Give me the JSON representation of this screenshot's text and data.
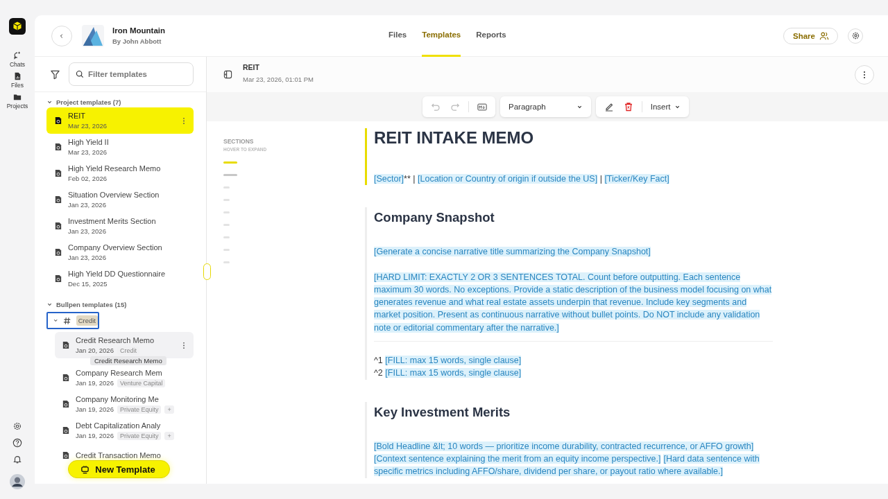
{
  "rail": {
    "nav": [
      {
        "kind": "chats",
        "label": "Chats"
      },
      {
        "kind": "files",
        "label": "Files"
      },
      {
        "kind": "projects",
        "label": "Projects"
      }
    ]
  },
  "header": {
    "project": "Iron Mountain",
    "byline": "By John Abbott",
    "tabs": [
      {
        "label": "Files",
        "selected": false
      },
      {
        "label": "Templates",
        "selected": true
      },
      {
        "label": "Reports",
        "selected": false
      }
    ],
    "share": "Share"
  },
  "sidebar": {
    "filter": {
      "placeholder": "Filter templates"
    },
    "project_group": {
      "title": "Project templates (7)",
      "expanded": true,
      "items": [
        {
          "name": "REIT",
          "date": "Mar 23, 2026",
          "selected": true
        },
        {
          "name": "High Yield II",
          "date": "Mar 23, 2026",
          "selected": false
        },
        {
          "name": "High Yield Research Memo",
          "date": "Feb 02, 2026",
          "selected": false
        },
        {
          "name": "Situation Overview Section",
          "date": "Jan 23, 2026",
          "selected": false
        },
        {
          "name": "Investment Merits Section",
          "date": "Jan 23, 2026",
          "selected": false
        },
        {
          "name": "Company Overview Section",
          "date": "Jan 23, 2026",
          "selected": false
        },
        {
          "name": "High Yield DD Questionnaire",
          "date": "Dec 15, 2025",
          "selected": false
        }
      ]
    },
    "bullpen_group": {
      "title": "Bullpen templates (15)",
      "expanded": true,
      "tag_group": {
        "tag": "Credit",
        "expanded": true,
        "selected": true,
        "items": [
          {
            "name": "Credit Research Memo",
            "date": "Jan 20, 2026",
            "tags": [
              "Credit"
            ],
            "highlighted": true,
            "tooltip": "Credit Research Memo"
          },
          {
            "name": "Company Research Mem",
            "date": "Jan 19, 2026",
            "tags": [
              "Venture Capital"
            ],
            "highlighted": false
          },
          {
            "name": "Company Monitoring Me",
            "date": "Jan 19, 2026",
            "tags": [
              "Private Equity",
              "+"
            ],
            "highlighted": false
          },
          {
            "name": "Debt Capitalization Analy",
            "date": "Jan 19, 2026",
            "tags": [
              "Private Equity",
              "+"
            ],
            "highlighted": false
          },
          {
            "name": "Credit Transaction Memo",
            "highlighted": false
          }
        ]
      }
    },
    "new_button": "New Template"
  },
  "editor": {
    "title": "REIT",
    "timestamp": "Mar 23, 2026, 01:01 PM",
    "toolbar": {
      "undo_disabled": true,
      "redo_disabled": true,
      "block_style": "Paragraph",
      "insert": "Insert"
    },
    "outline": {
      "title": "SECTIONS",
      "hint": "HOVER TO EXPAND",
      "marks": [
        {
          "kind": "h1",
          "selected": true
        },
        {
          "kind": "h2",
          "selected": false
        },
        {
          "kind": "h3",
          "selected": false
        },
        {
          "kind": "h3",
          "selected": false
        },
        {
          "kind": "h3",
          "selected": false
        },
        {
          "kind": "h3",
          "selected": false
        },
        {
          "kind": "h3",
          "selected": false
        },
        {
          "kind": "h3",
          "selected": false
        },
        {
          "kind": "h3",
          "selected": false
        }
      ]
    },
    "blocks": [
      {
        "kind": "title",
        "selected": true,
        "heading": "REIT INTAKE MEMO",
        "paragraphs": [
          {
            "kind": "text",
            "segments": [
              {
                "kind": "placeholder",
                "text": "[Sector]"
              },
              {
                "kind": "plain",
                "text": "** | "
              },
              {
                "kind": "placeholder",
                "text": "[Location or Country of origin if outside the US]"
              },
              {
                "kind": "plain",
                "text": " | "
              },
              {
                "kind": "placeholder",
                "text": "[Ticker/Key Fact]"
              }
            ]
          }
        ]
      },
      {
        "kind": "section",
        "selected": false,
        "heading": "Company Snapshot",
        "paragraphs": [
          {
            "kind": "text",
            "segments": [
              {
                "kind": "placeholder",
                "text": "[Generate a concise narrative title summarizing the Company Snapshot]"
              }
            ]
          },
          {
            "kind": "text",
            "segments": [
              {
                "kind": "placeholder",
                "text": "[HARD LIMIT: EXACTLY 2 OR 3 SENTENCES TOTAL. Count before outputting. Each sentence maximum 30 words. No exceptions. Provide a static description of the business model focusing on what generates revenue and what real estate assets underpin that revenue. Include key segments and market position. Present as continuous narrative without bullet points. Do NOT include any validation note or editorial commentary after the narrative.]"
              }
            ]
          },
          {
            "kind": "rule"
          },
          {
            "kind": "note",
            "segments": [
              {
                "kind": "plain",
                "text": "^1 "
              },
              {
                "kind": "placeholder",
                "text": "[FILL: max 15 words, single clause]"
              }
            ]
          },
          {
            "kind": "note",
            "segments": [
              {
                "kind": "plain",
                "text": "^2 "
              },
              {
                "kind": "placeholder",
                "text": "[FILL: max 15 words, single clause]"
              }
            ]
          }
        ]
      },
      {
        "kind": "section",
        "selected": false,
        "heading": "Key Investment Merits",
        "paragraphs": [
          {
            "kind": "text",
            "segments": [
              {
                "kind": "placeholder",
                "text": "[Bold Headline &lt; 10 words — prioritize income durability, contracted recurrence, or AFFO growth]"
              },
              {
                "kind": "placeholder",
                "text": "[Context sentence explaining the merit from an equity income perspective.]"
              },
              {
                "kind": "placeholder",
                "text": "[Hard data sentence with specific metrics including AFFO/share, dividend per share, or payout ratio where available.]"
              }
            ]
          }
        ]
      }
    ]
  }
}
